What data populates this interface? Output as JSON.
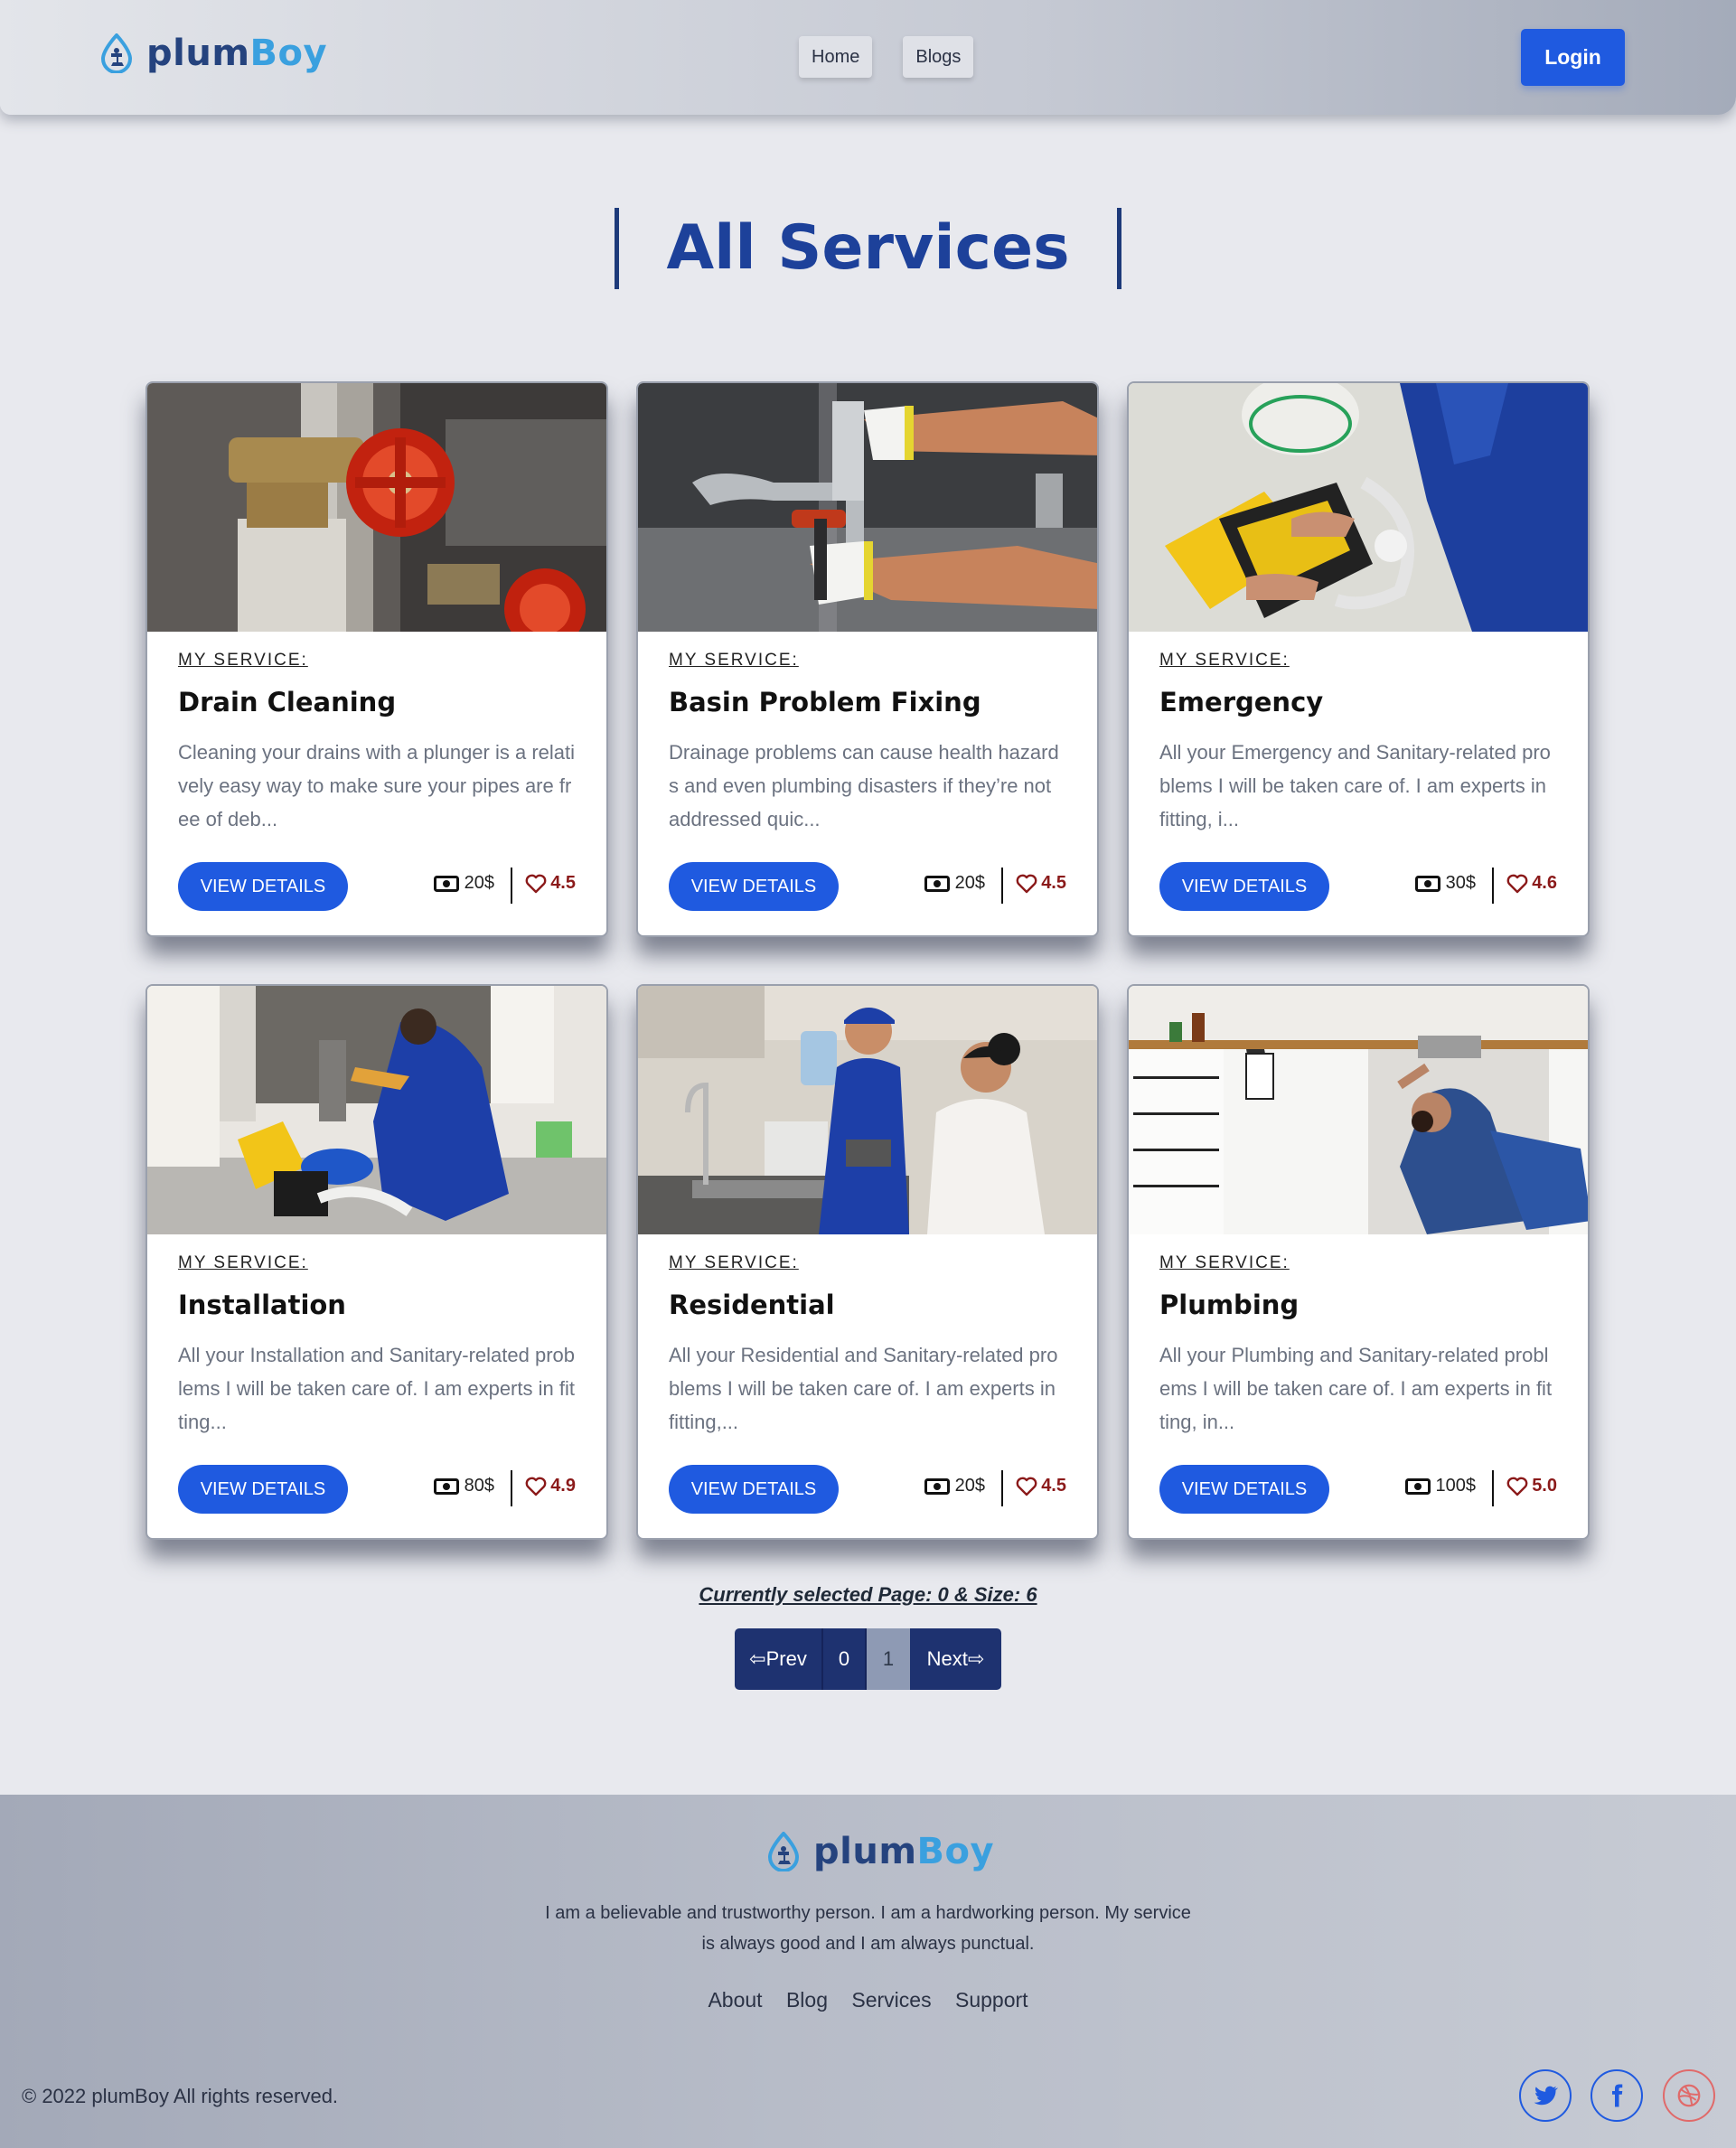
{
  "header": {
    "brand": {
      "part1": "plum",
      "part2": "Boy"
    },
    "nav": [
      {
        "label": "Home"
      },
      {
        "label": "Blogs"
      }
    ],
    "login_label": "Login"
  },
  "page_title": "All Services",
  "cards": [
    {
      "kicker": "MY SERVICE:",
      "title": "Drain Cleaning",
      "desc": "Cleaning your drains with a plunger is a relatively easy way to make sure your pipes are free of deb...",
      "button": "VIEW DETAILS",
      "price": "20$",
      "rating": "4.5",
      "image": "red valve on pipes"
    },
    {
      "kicker": "MY SERVICE:",
      "title": "Basin Problem Fixing",
      "desc": "Drainage problems can cause health hazards and even plumbing disasters if they’re not addressed quic...",
      "button": "VIEW DETAILS",
      "price": "20$",
      "rating": "4.5",
      "image": "gloved hands with wrench"
    },
    {
      "kicker": "MY SERVICE:",
      "title": "Emergency",
      "desc": "All your Emergency and Sanitary-related problems I will be taken care of. I am experts in fitting, i...",
      "button": "VIEW DETAILS",
      "price": "30$",
      "rating": "4.6",
      "image": "plumber with toolbox"
    },
    {
      "kicker": "MY SERVICE:",
      "title": "Installation",
      "desc": "All your Installation and Sanitary-related problems I will be taken care of. I am experts in fitting...",
      "button": "VIEW DETAILS",
      "price": "80$",
      "rating": "4.9",
      "image": "plumber under sink"
    },
    {
      "kicker": "MY SERVICE:",
      "title": "Residential",
      "desc": "All your Residential and Sanitary-related problems I will be taken care of. I am experts in fitting,...",
      "button": "VIEW DETAILS",
      "price": "20$",
      "rating": "4.5",
      "image": "plumber with client in kitchen"
    },
    {
      "kicker": "MY SERVICE:",
      "title": "Plumbing",
      "desc": "All your Plumbing and Sanitary-related problems I will be taken care of. I am experts in fitting, in...",
      "button": "VIEW DETAILS",
      "price": "100$",
      "rating": "5.0",
      "image": "plumber lying under kitchen sink"
    }
  ],
  "pagination": {
    "info": "Currently selected Page: 0 & Size: 6",
    "prev": "⇦Prev",
    "pages": [
      "0",
      "1"
    ],
    "next": "Next⇨",
    "selected_page_display": "1"
  },
  "footer": {
    "brand": {
      "part1": "plum",
      "part2": "Boy"
    },
    "desc": "I am a believable and trustworthy person. I am a hardworking person. My service is always good and I am always punctual.",
    "links": [
      "About",
      "Blog",
      "Services",
      "Support"
    ],
    "copyright": "© 2022 plumBoy All rights reserved.",
    "social": [
      "twitter-icon",
      "facebook-icon",
      "dribbble-icon"
    ]
  },
  "colors": {
    "accent": "#1f5ae0",
    "title": "#1d419a",
    "rating": "#8b1a1a",
    "pager": "#1e3270"
  }
}
